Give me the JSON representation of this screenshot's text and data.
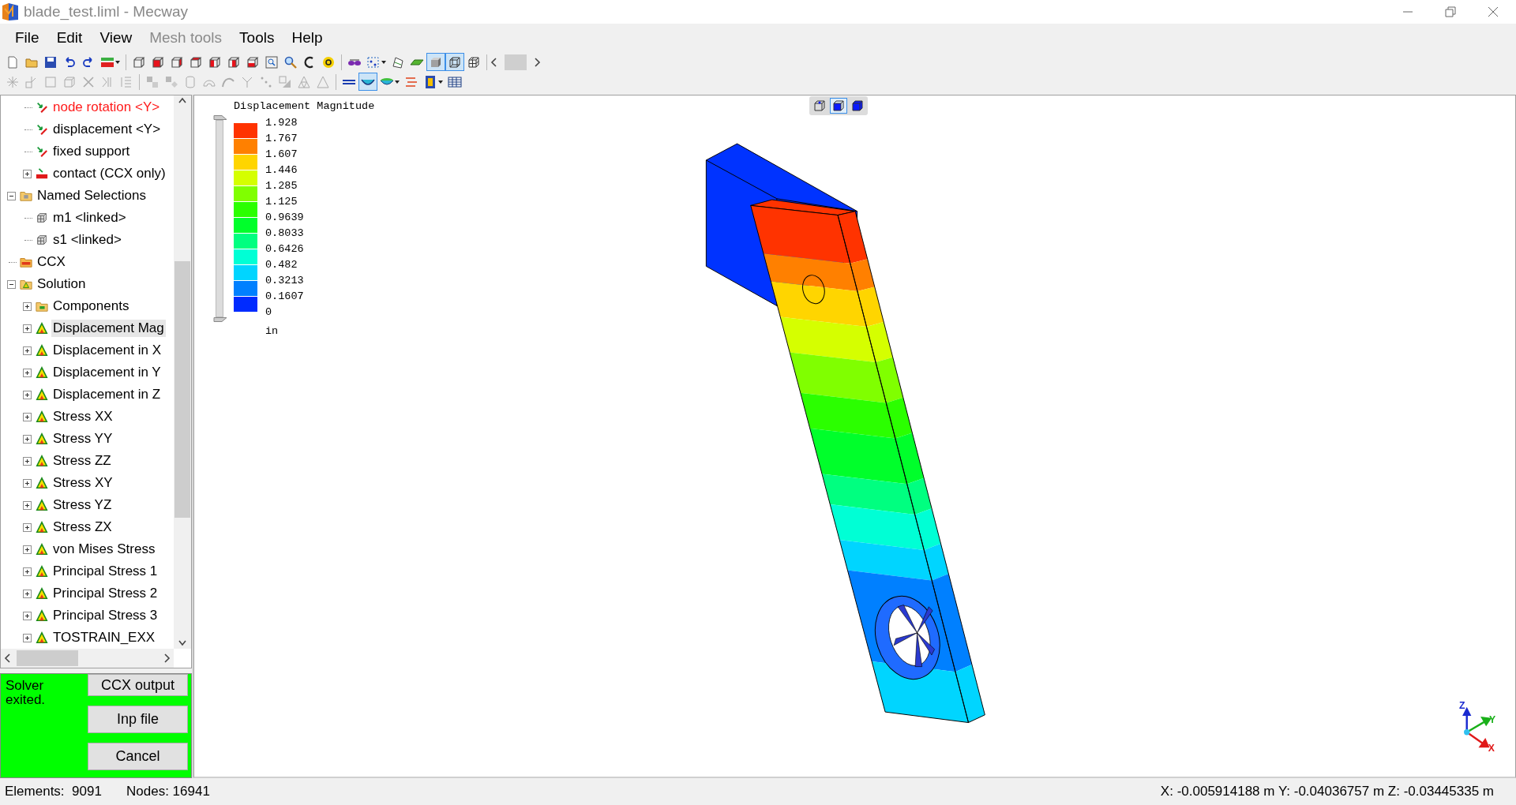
{
  "window": {
    "title": "blade_test.liml - Mecway"
  },
  "menu": [
    {
      "label": "File",
      "disabled": false
    },
    {
      "label": "Edit",
      "disabled": false
    },
    {
      "label": "View",
      "disabled": false
    },
    {
      "label": "Mesh tools",
      "disabled": true
    },
    {
      "label": "Tools",
      "disabled": false
    },
    {
      "label": "Help",
      "disabled": false
    }
  ],
  "toolbar_1": {
    "groups": [
      [
        {
          "pressed": false,
          "dropdown": false
        },
        {
          "pressed": false,
          "dropdown": false
        },
        {
          "pressed": false,
          "dropdown": false
        },
        {
          "pressed": false,
          "dropdown": false
        },
        {
          "pressed": false,
          "dropdown": false
        },
        {
          "pressed": false,
          "dropdown": true
        }
      ],
      [
        {
          "pressed": false,
          "dropdown": false
        },
        {
          "pressed": false,
          "dropdown": false
        },
        {
          "pressed": false,
          "dropdown": false
        },
        {
          "pressed": false,
          "dropdown": false
        },
        {
          "pressed": false,
          "dropdown": false
        },
        {
          "pressed": false,
          "dropdown": false
        },
        {
          "pressed": false,
          "dropdown": false
        },
        {
          "pressed": false,
          "dropdown": false
        },
        {
          "pressed": false,
          "dropdown": false
        },
        {
          "pressed": false,
          "dropdown": false
        },
        {
          "pressed": false,
          "dropdown": false
        }
      ],
      [
        {
          "pressed": false,
          "dropdown": false
        },
        {
          "pressed": false,
          "dropdown": true
        },
        {
          "pressed": false,
          "dropdown": false
        },
        {
          "pressed": false,
          "dropdown": false
        },
        {
          "pressed": true,
          "dropdown": false
        },
        {
          "pressed": true,
          "dropdown": false
        },
        {
          "pressed": false,
          "dropdown": false
        }
      ]
    ]
  },
  "toolbar_2": {
    "groups": [
      [
        {
          "pressed": false,
          "dropdown": false,
          "disabled": true
        },
        {
          "pressed": false,
          "dropdown": false,
          "disabled": true
        },
        {
          "pressed": false,
          "dropdown": false,
          "disabled": true
        },
        {
          "pressed": false,
          "dropdown": false,
          "disabled": true
        },
        {
          "pressed": false,
          "dropdown": false,
          "disabled": true
        },
        {
          "pressed": false,
          "dropdown": false,
          "disabled": true
        },
        {
          "pressed": false,
          "dropdown": false,
          "disabled": true
        }
      ],
      [
        {
          "pressed": false,
          "dropdown": false,
          "disabled": true
        },
        {
          "pressed": false,
          "dropdown": false,
          "disabled": true
        },
        {
          "pressed": false,
          "dropdown": false,
          "disabled": true
        },
        {
          "pressed": false,
          "dropdown": false,
          "disabled": true
        },
        {
          "pressed": false,
          "dropdown": false,
          "disabled": true
        },
        {
          "pressed": false,
          "dropdown": false,
          "disabled": true
        },
        {
          "pressed": false,
          "dropdown": false,
          "disabled": true
        },
        {
          "pressed": false,
          "dropdown": false,
          "disabled": true
        },
        {
          "pressed": false,
          "dropdown": false,
          "disabled": true
        },
        {
          "pressed": false,
          "dropdown": false,
          "disabled": true
        }
      ],
      [
        {
          "pressed": false,
          "dropdown": false,
          "disabled": false
        },
        {
          "pressed": true,
          "dropdown": false,
          "disabled": false
        },
        {
          "pressed": false,
          "dropdown": true,
          "disabled": false
        },
        {
          "pressed": false,
          "dropdown": false,
          "disabled": false
        },
        {
          "pressed": false,
          "dropdown": true,
          "disabled": false
        },
        {
          "pressed": false,
          "dropdown": false,
          "disabled": false
        }
      ]
    ]
  },
  "tree": {
    "partial_branch": [
      {
        "label": "node rotation <Y>",
        "kind": "constraint",
        "invalid": true,
        "selected": false
      },
      {
        "label": "displacement <Y>",
        "kind": "constraint",
        "invalid": false,
        "selected": false
      },
      {
        "label": "fixed support",
        "kind": "constraint",
        "invalid": false,
        "selected": false
      },
      {
        "label": "contact (CCX only)",
        "kind": "contact",
        "invalid": false,
        "selected": false,
        "expanded": false
      }
    ],
    "items": [
      {
        "label": "Named Selections",
        "kind": "folder",
        "selected": false,
        "expanded": true,
        "children": [
          {
            "label": "m1 <linked>",
            "kind": "selection",
            "selected": false
          },
          {
            "label": "s1 <linked>",
            "kind": "selection",
            "selected": false
          }
        ]
      },
      {
        "label": "CCX",
        "kind": "ccx",
        "selected": false
      },
      {
        "label": "Solution",
        "kind": "solution",
        "selected": false,
        "expanded": true,
        "children": [
          {
            "label": "Components",
            "kind": "components",
            "selected": false,
            "expanded": false
          },
          {
            "label": "Displacement Mag",
            "kind": "result",
            "selected": true,
            "expanded": false
          },
          {
            "label": "Displacement in X",
            "kind": "result",
            "selected": false,
            "expanded": false
          },
          {
            "label": "Displacement in Y",
            "kind": "result",
            "selected": false,
            "expanded": false
          },
          {
            "label": "Displacement in Z",
            "kind": "result",
            "selected": false,
            "expanded": false
          },
          {
            "label": "Stress XX",
            "kind": "result",
            "selected": false,
            "expanded": false
          },
          {
            "label": "Stress YY",
            "kind": "result",
            "selected": false,
            "expanded": false
          },
          {
            "label": "Stress ZZ",
            "kind": "result",
            "selected": false,
            "expanded": false
          },
          {
            "label": "Stress XY",
            "kind": "result",
            "selected": false,
            "expanded": false
          },
          {
            "label": "Stress YZ",
            "kind": "result",
            "selected": false,
            "expanded": false
          },
          {
            "label": "Stress ZX",
            "kind": "result",
            "selected": false,
            "expanded": false
          },
          {
            "label": "von Mises Stress",
            "kind": "result",
            "selected": false,
            "expanded": false
          },
          {
            "label": "Principal Stress 1",
            "kind": "result",
            "selected": false,
            "expanded": false
          },
          {
            "label": "Principal Stress 2",
            "kind": "result",
            "selected": false,
            "expanded": false
          },
          {
            "label": "Principal Stress 3",
            "kind": "result",
            "selected": false,
            "expanded": false
          },
          {
            "label": "TOSTRAIN_EXX",
            "kind": "result",
            "selected": false,
            "expanded": false
          }
        ]
      }
    ]
  },
  "solver": {
    "message": "Solver exited.",
    "buttons": [
      "CCX output",
      "Inp file",
      "Cancel"
    ]
  },
  "view_modes": [
    {
      "selected": false
    },
    {
      "selected": true
    },
    {
      "selected": false
    }
  ],
  "legend": {
    "title": "Displacement Magnitude",
    "values": [
      "1.928",
      "1.767",
      "1.607",
      "1.446",
      "1.285",
      "1.125",
      "0.9639",
      "0.8033",
      "0.6426",
      "0.482",
      "0.3213",
      "0.1607",
      "0"
    ],
    "bands": [
      {
        "color": "#ff3300"
      },
      {
        "color": "#ff8000"
      },
      {
        "color": "#ffd500"
      },
      {
        "color": "#d5ff00"
      },
      {
        "color": "#80ff00"
      },
      {
        "color": "#2bff00"
      },
      {
        "color": "#00ff2b"
      },
      {
        "color": "#00ff80"
      },
      {
        "color": "#00ffd5"
      },
      {
        "color": "#00d5ff"
      },
      {
        "color": "#0080ff"
      },
      {
        "color": "#002bff"
      }
    ],
    "unit": "in",
    "range_slider": {
      "level": 1
    }
  },
  "axis_triad": {
    "labels": [
      "Z",
      "Y",
      "X"
    ]
  },
  "status_bar": {
    "elements": "Elements:  9091",
    "nodes": "Nodes: 16941",
    "coordinates": "X: -0.005914188 m Y: -0.04036757 m Z: -0.03445335 m"
  }
}
